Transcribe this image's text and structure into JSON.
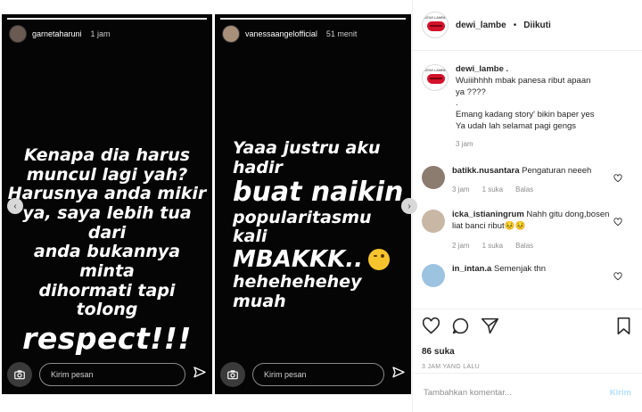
{
  "stories": [
    {
      "username": "garnetaharuni",
      "time": "1 jam",
      "text_lines": [
        "Kenapa dia harus",
        "muncul lagi yah?",
        "Harusnya anda mikir",
        "ya, saya lebih tua dari",
        "anda bukannya minta",
        "dihormati tapi tolong"
      ],
      "text_big": "respect!!!",
      "message_placeholder": "Kirim pesan"
    },
    {
      "username": "vanessaangelofficial",
      "time": "51 menit",
      "line1": "Yaaa justru aku hadir",
      "line2": "buat naikin",
      "line3": "popularitasmu kali",
      "line4": "MBAKKK..",
      "line5": "hehehehehey muah",
      "message_placeholder": "Kirim pesan"
    }
  ],
  "nav": {
    "prev": "‹",
    "next": "›"
  },
  "post": {
    "username": "dewi_lambe",
    "separator": "•",
    "follow_status": "Diikuti",
    "logo_text": "DEWI LAMBE"
  },
  "caption": {
    "username": "dewi_lambe .",
    "lines": [
      "Wuiiihhhh mbak panesa ribut apaan",
      "ya ????",
      ".",
      "Emang kadang story' bikin baper yes",
      "Ya udah lah selamat pagi gengs"
    ],
    "time": "3 jam"
  },
  "comments": [
    {
      "username": "batikk.nusantara",
      "text": "Pengaturan neeeh",
      "time": "3 jam",
      "likes": "1 suka",
      "reply": "Balas"
    },
    {
      "username": "icka_istianingrum",
      "text": "Nahh gitu dong,bosen liat banci ribut😣😣",
      "time": "2 jam",
      "likes": "1 suka",
      "reply": "Balas"
    },
    {
      "username": "in_intan.a",
      "text": "Semenjak thn"
    }
  ],
  "likes_count": "86 suka",
  "posted_ago": "3 JAM YANG LALU",
  "add_comment": {
    "placeholder": "Tambahkan komentar...",
    "post_label": "Kirim"
  },
  "colors": {
    "accent": "#d4122b",
    "post_button": "#b2dffc",
    "muted": "#8e8e8e"
  }
}
